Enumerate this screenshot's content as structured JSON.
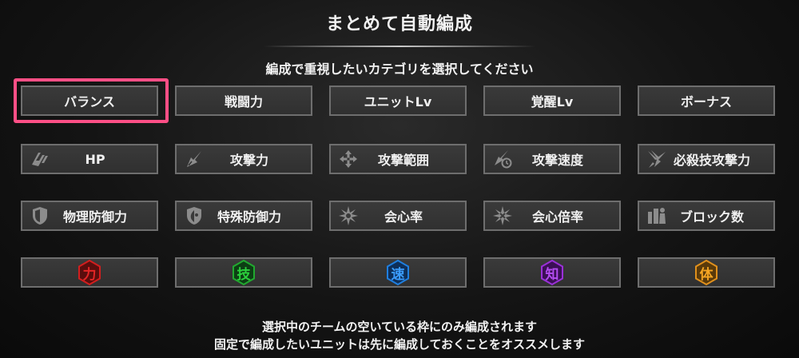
{
  "title": "まとめて自動編成",
  "subtitle": "編成で重視したいカテゴリを選択してください",
  "rows": [
    [
      {
        "label": "バランス",
        "icon": null
      },
      {
        "label": "戦闘力",
        "icon": null
      },
      {
        "label": "ユニットLv",
        "icon": null
      },
      {
        "label": "覚醒Lv",
        "icon": null
      },
      {
        "label": "ボーナス",
        "icon": null
      }
    ],
    [
      {
        "label": "HP",
        "icon": "hp-icon"
      },
      {
        "label": "攻撃力",
        "icon": "attack-icon"
      },
      {
        "label": "攻撃範囲",
        "icon": "attack-range-icon"
      },
      {
        "label": "攻撃速度",
        "icon": "attack-speed-icon"
      },
      {
        "label": "必殺技攻撃力",
        "icon": "special-attack-icon"
      }
    ],
    [
      {
        "label": "物理防御力",
        "icon": "physical-defense-icon"
      },
      {
        "label": "特殊防御力",
        "icon": "special-defense-icon"
      },
      {
        "label": "会心率",
        "icon": "critical-rate-icon"
      },
      {
        "label": "会心倍率",
        "icon": "critical-multiplier-icon"
      },
      {
        "label": "ブロック数",
        "icon": "block-count-icon"
      }
    ]
  ],
  "attributes": [
    {
      "label": "力",
      "color": "#d21e1e"
    },
    {
      "label": "技",
      "color": "#21a92f"
    },
    {
      "label": "速",
      "color": "#1f7fe0"
    },
    {
      "label": "知",
      "color": "#9a30d8"
    },
    {
      "label": "体",
      "color": "#e0901c"
    }
  ],
  "selected": "バランス",
  "selection_color": "#ff4f86",
  "footer": {
    "line1": "選択中のチームの空いている枠にのみ編成されます",
    "line2": "固定で編成したいユニットは先に編成しておくことをオススメします"
  }
}
